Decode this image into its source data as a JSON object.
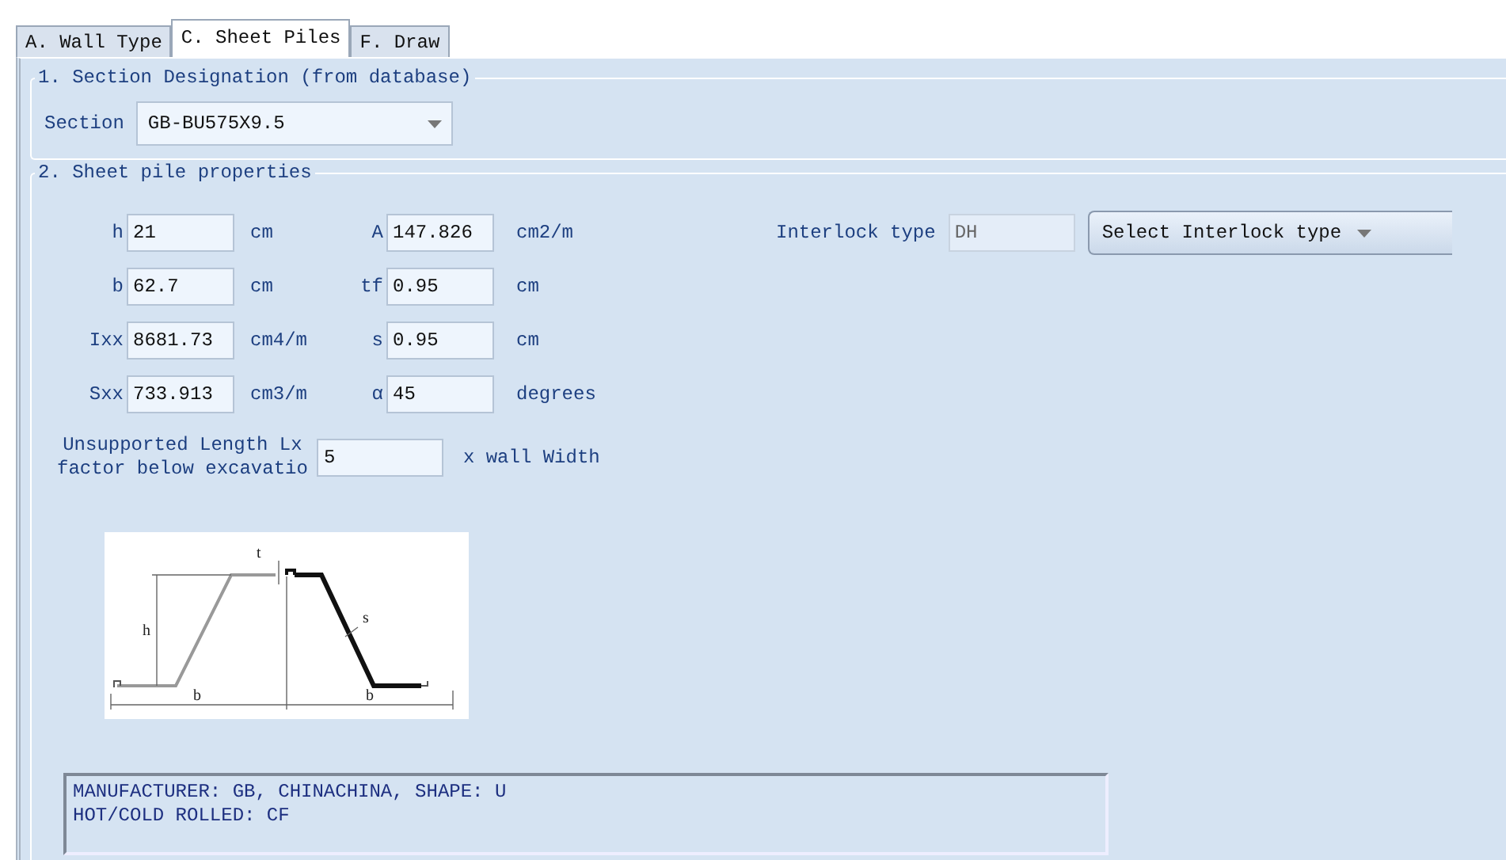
{
  "tabs": [
    {
      "label": "A. Wall Type",
      "selected": false
    },
    {
      "label": "C. Sheet Piles",
      "selected": true
    },
    {
      "label": "F. Draw",
      "selected": false
    }
  ],
  "section_group": {
    "title": "1. Section Designation (from database)",
    "label": "Section",
    "value": "GB-BU575X9.5"
  },
  "properties_group": {
    "title": "2. Sheet pile properties",
    "rows": [
      {
        "left": {
          "label": "h",
          "value": "21",
          "unit": "cm"
        },
        "right": {
          "label": "A",
          "value": "147.826",
          "unit": "cm2/m"
        }
      },
      {
        "left": {
          "label": "b",
          "value": "62.7",
          "unit": "cm"
        },
        "right": {
          "label": "tf",
          "value": "0.95",
          "unit": "cm"
        }
      },
      {
        "left": {
          "label": "Ixx",
          "value": "8681.73",
          "unit": "cm4/m"
        },
        "right": {
          "label": "s",
          "value": "0.95",
          "unit": "cm"
        }
      },
      {
        "left": {
          "label": "Sxx",
          "value": "733.913",
          "unit": "cm3/m"
        },
        "right": {
          "label": "α",
          "value": "45",
          "unit": "degrees"
        }
      }
    ],
    "interlock": {
      "label": "Interlock type",
      "value": "DH",
      "select": "Select Interlock type"
    },
    "lx": {
      "label_lines": [
        "Unsupported Length Lx",
        "factor below excavatio"
      ],
      "value": "5",
      "unit": "x wall Width"
    },
    "diagram_labels": {
      "t": "t",
      "h": "h",
      "s": "s",
      "b_left": "b",
      "b_right": "b"
    },
    "info_lines": [
      "MANUFACTURER: GB, CHINACHINA, SHAPE: U",
      "HOT/COLD ROLLED: CF"
    ]
  }
}
